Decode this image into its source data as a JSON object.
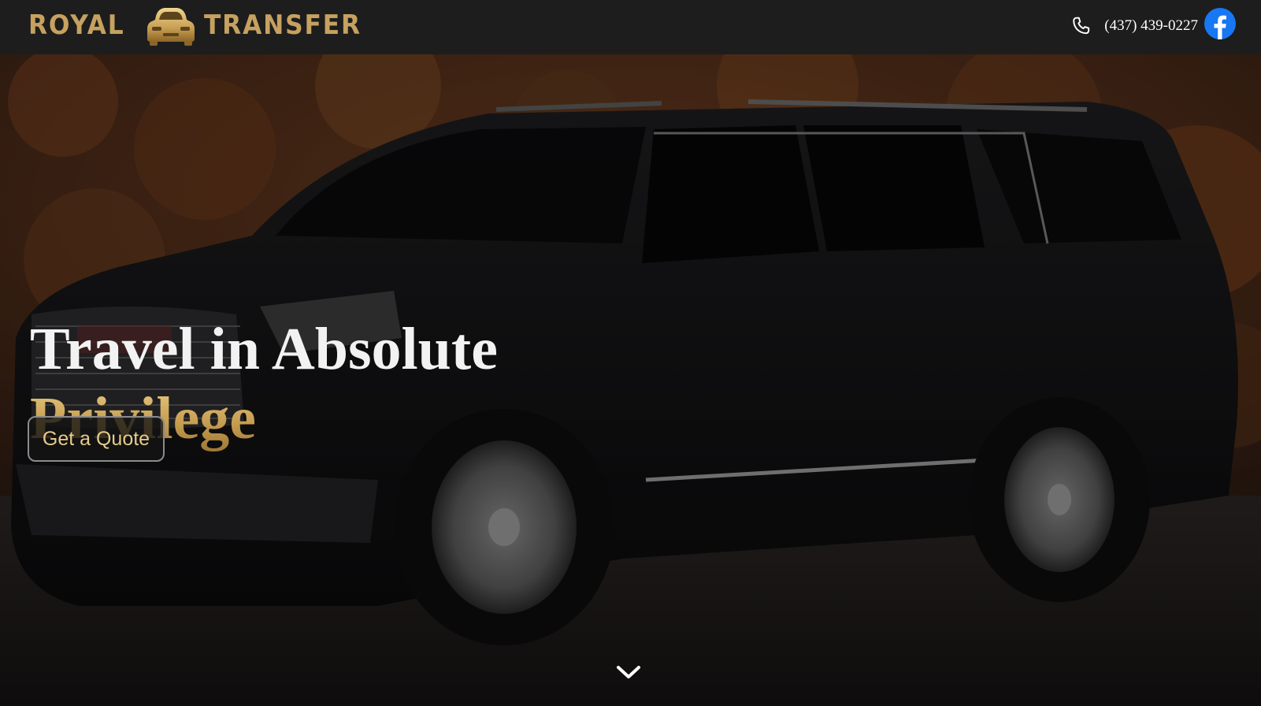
{
  "header": {
    "brand_left": "ROYAL",
    "brand_right": "TRANSFER",
    "phone": "(437) 439-0227",
    "icons": {
      "phone": "phone-icon",
      "social": "facebook-icon",
      "logo": "car-logo-icon"
    }
  },
  "hero": {
    "headline_line1": "Travel in Absolute",
    "headline_line2": "Privilege",
    "cta_label": "Get a Quote",
    "scroll_icon": "chevron-down-icon"
  },
  "colors": {
    "accent_gold": "#c6a15f",
    "header_bg": "#1d1d1d",
    "facebook_blue": "#1877f2",
    "text_white": "#f2f2f2"
  }
}
